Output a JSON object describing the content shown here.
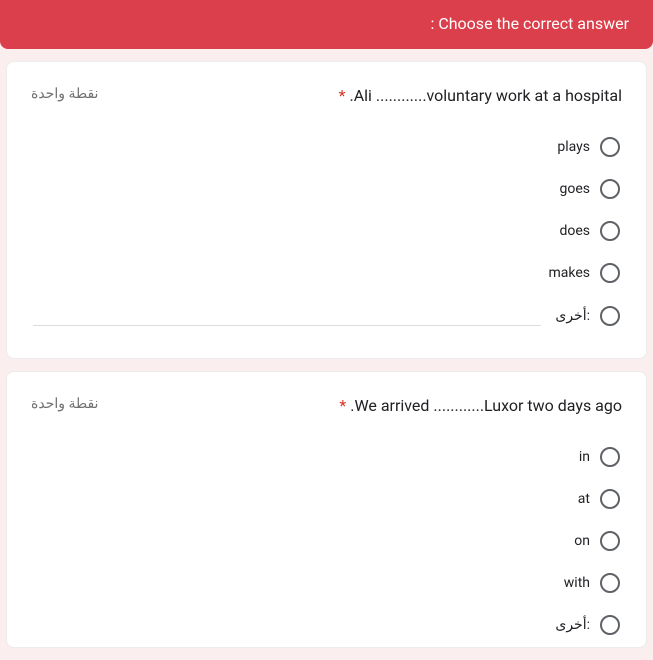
{
  "header": {
    "title": ": Choose the correct answer"
  },
  "q1": {
    "points": "نقطة واحدة",
    "required": "*",
    "text": ".Ali ............voluntary work at a hospital",
    "options": [
      "plays",
      "goes",
      "does",
      "makes"
    ],
    "other_label": "أخرى:"
  },
  "q2": {
    "points": "نقطة واحدة",
    "required": "*",
    "text": ".We arrived ............Luxor two days ago",
    "options": [
      "in",
      "at",
      "on",
      "with"
    ],
    "other_label": "أخرى:"
  }
}
